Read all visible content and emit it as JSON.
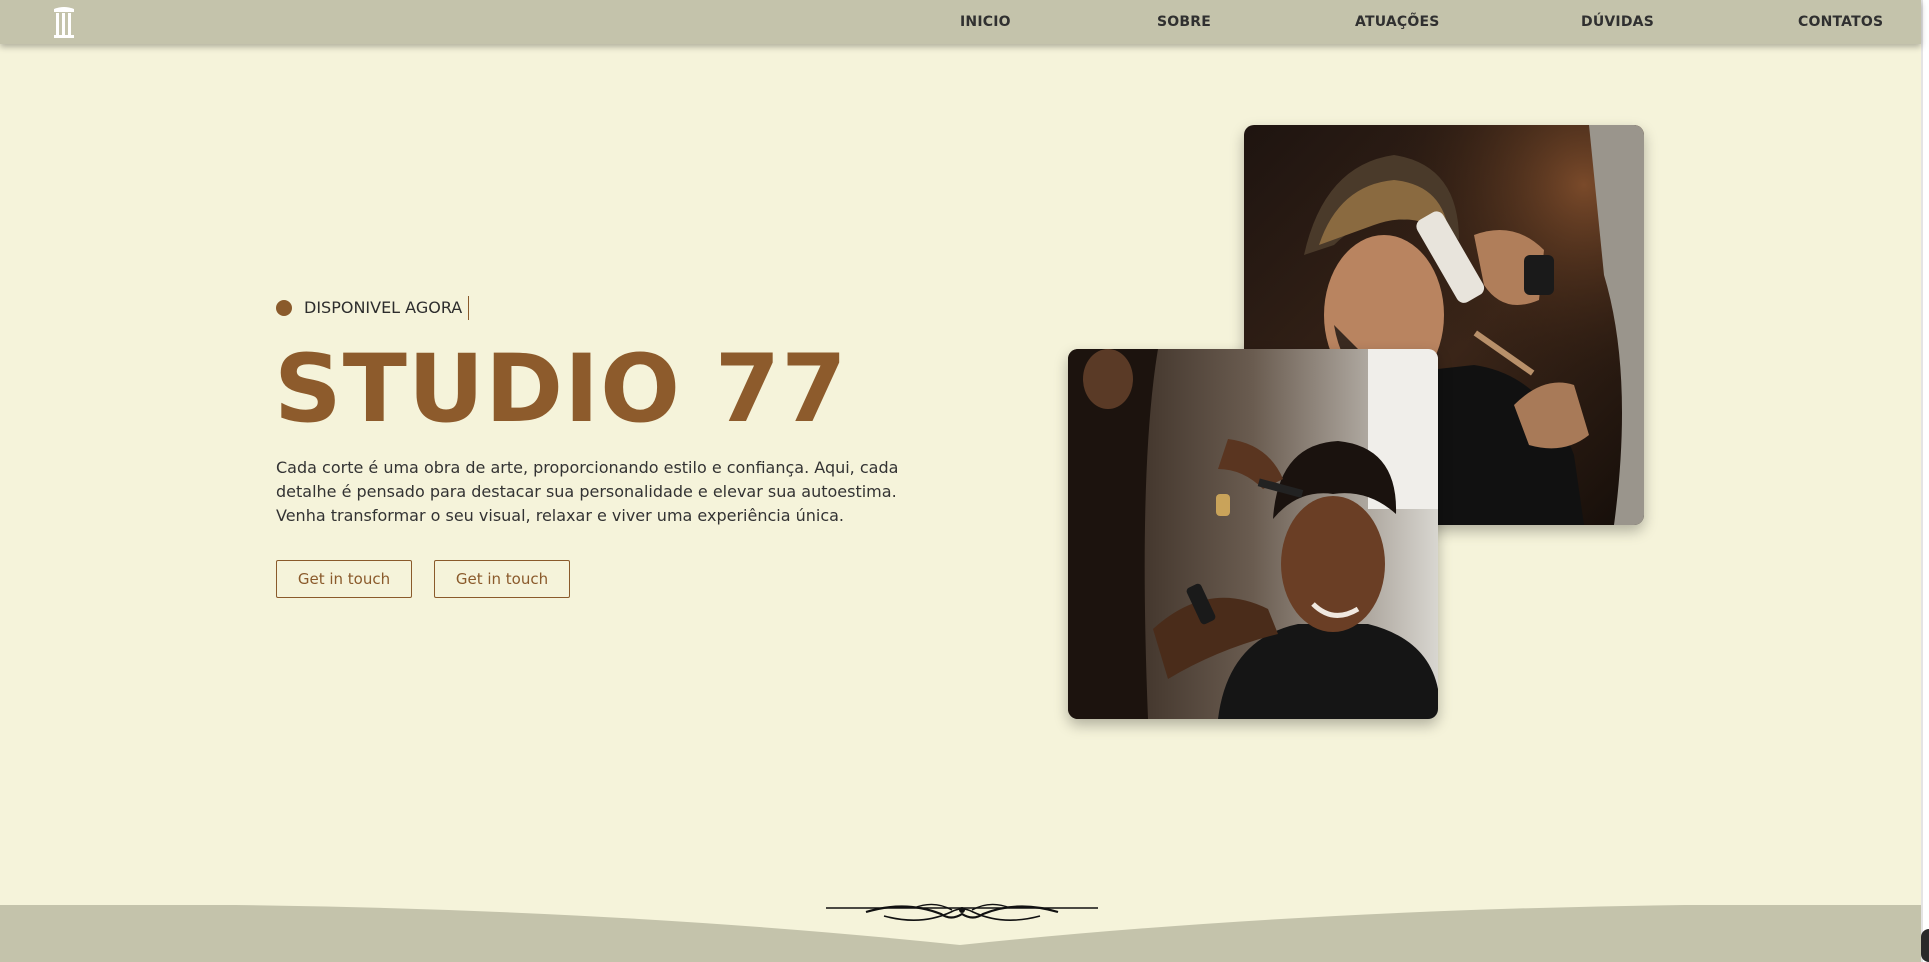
{
  "nav": {
    "links": [
      "INICIO",
      "SOBRE",
      "ATUAÇÕES",
      "DÚVIDAS",
      "CONTATOS"
    ]
  },
  "hero": {
    "badge": "DISPONIVEL AGORA",
    "title": "STUDIO 77",
    "description": "Cada corte é uma obra de arte, proporcionando estilo e confiança. Aqui, cada detalhe é pensado para destacar sua personalidade e elevar sua autoestima. Venha transformar o seu visual, relaxar e viver uma experiência única.",
    "buttons": [
      "Get in touch",
      "Get in touch"
    ]
  },
  "colors": {
    "background": "#f5f3da",
    "navbar": "#c4c3ab",
    "accent": "#8d5b2c",
    "text": "#333333"
  },
  "icons": {
    "logo": "column-pillar-icon",
    "footer": "flourish-ornament"
  }
}
